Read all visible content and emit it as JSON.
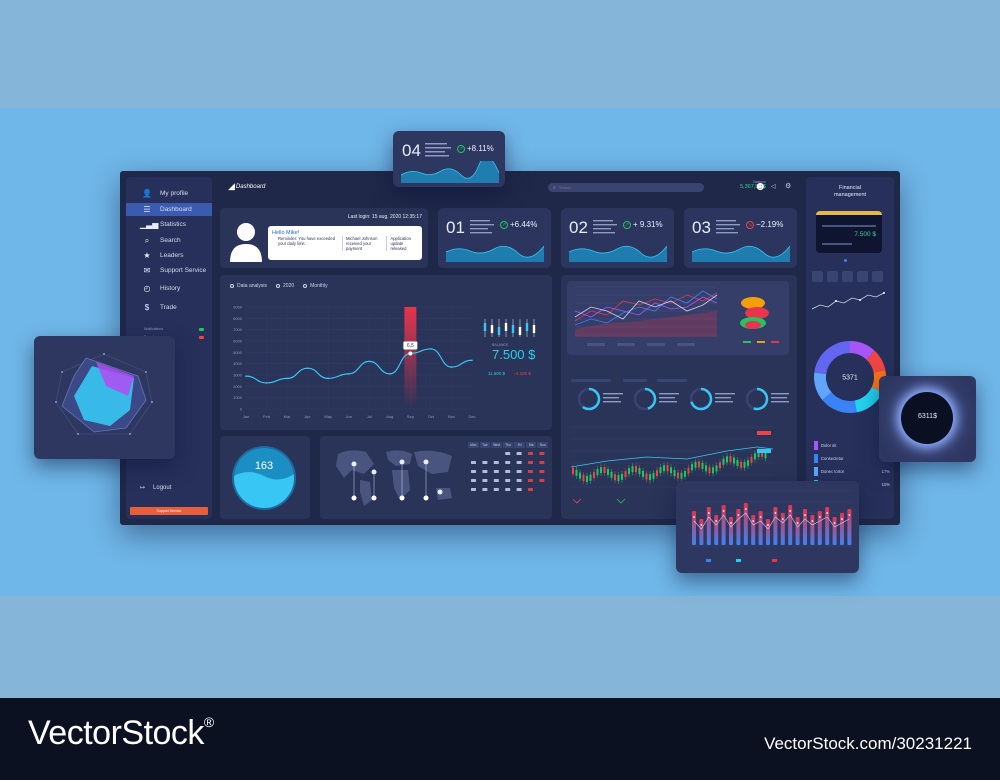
{
  "app": {
    "title": "Dashboard",
    "last_login": "Last login: 15 aug. 2020 12:35:17"
  },
  "search": {
    "placeholder": "Search"
  },
  "balance_top": {
    "label": "Balance",
    "value": "5,367,50 $"
  },
  "sidebar": {
    "items": [
      {
        "label": "My profile",
        "icon": "user-icon"
      },
      {
        "label": "Dashboard",
        "icon": "list-icon"
      },
      {
        "label": "Statistics",
        "icon": "bar-chart-icon"
      },
      {
        "label": "Search",
        "icon": "search-icon"
      },
      {
        "label": "Leaders",
        "icon": "star-icon"
      },
      {
        "label": "Support Service",
        "icon": "chat-icon"
      },
      {
        "label": "History",
        "icon": "clock-icon"
      },
      {
        "label": "Trade",
        "icon": "dollar-icon"
      }
    ],
    "toggles": [
      {
        "label": "Notifications"
      },
      {
        "label": "Sound"
      }
    ],
    "logout": "Logout",
    "support": "Support Service"
  },
  "welcome": {
    "greeting": "Hello Mike!",
    "reminder": "Reminder: You have exceeded your daily limit.",
    "message": "Michael Johnson received your payment",
    "update": "Application update released"
  },
  "kpis": [
    {
      "num": "01",
      "pct": "+6.44%",
      "dir": "up"
    },
    {
      "num": "02",
      "pct": "+ 9.31%",
      "dir": "up"
    },
    {
      "num": "03",
      "pct": "−2.19%",
      "dir": "down"
    }
  ],
  "float_kpi": {
    "num": "04",
    "pct": "+8.11%"
  },
  "data_analysis": {
    "options": [
      "Data analysis",
      "2020",
      "Monthly"
    ],
    "balance_label": "BALANCE",
    "balance": "7.500 $",
    "sub_values": [
      "11.600 $",
      "−4.190 $"
    ]
  },
  "gauge": {
    "value": "163"
  },
  "calendar": {
    "weekdays": [
      "Mon",
      "Tue",
      "Wed",
      "Thu",
      "Fri",
      "Sat",
      "Sun"
    ]
  },
  "financial": {
    "title": "Financial management",
    "card_balance": "7.500 $",
    "donut_total": "5371"
  },
  "legend": [
    {
      "label": "Dolor sit",
      "pct": "10%",
      "color": "#a855f7"
    },
    {
      "label": "Consectetur",
      "pct": "15%",
      "color": "#3b82f6"
    },
    {
      "label": "Donec tortor",
      "pct": "17%",
      "color": "#60a5fa"
    },
    {
      "label": "Nunc dapibus",
      "pct": "10%",
      "color": "#22d3ee"
    }
  ],
  "eclipse": {
    "value": "6311$"
  },
  "chart_data": {
    "type": "line",
    "title": "",
    "categories": [
      "Jan",
      "Feb",
      "Mar",
      "Apr",
      "May",
      "Jun",
      "Jul",
      "Aug",
      "Sep",
      "Oct",
      "Nov",
      "Dec"
    ],
    "series": [
      {
        "values": [
          2900,
          2300,
          2700,
          3600,
          2700,
          3100,
          4200,
          3100,
          4900,
          5300,
          3700,
          4300
        ]
      }
    ],
    "ylim": [
      0,
      9000
    ],
    "yticks": [
      0,
      1000,
      2000,
      3000,
      4000,
      5000,
      6000,
      7000,
      8000,
      9000
    ],
    "highlight": {
      "category": "Sep",
      "value": "6,5"
    }
  }
}
